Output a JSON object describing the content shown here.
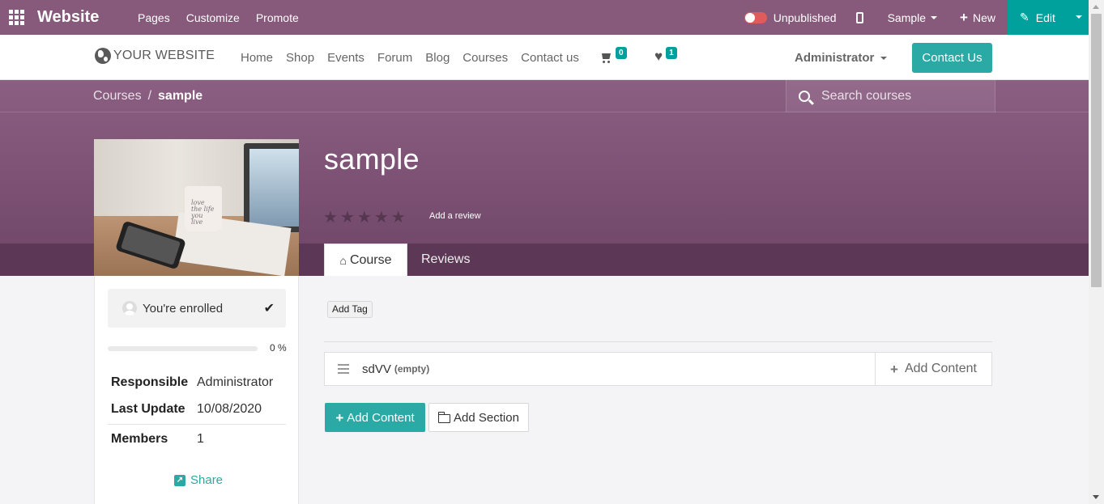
{
  "adminbar": {
    "app_title": "Website",
    "menu": [
      "Pages",
      "Customize",
      "Promote"
    ],
    "publish_status": "Unpublished",
    "sample_label": "Sample",
    "new_label": "New",
    "edit_label": "Edit"
  },
  "sitenav": {
    "logo_text": "YOUR WEBSITE",
    "links": [
      "Home",
      "Shop",
      "Events",
      "Forum",
      "Blog",
      "Courses",
      "Contact us"
    ],
    "cart_count": "0",
    "wishlist_count": "1",
    "user": "Administrator",
    "contact_button": "Contact Us"
  },
  "breadcrumb": {
    "parent": "Courses",
    "separator": "/",
    "current": "sample"
  },
  "search": {
    "placeholder": "Search courses"
  },
  "course": {
    "title": "sample",
    "rating_stars": 0,
    "add_review": "Add a review",
    "tabs": [
      "Course",
      "Reviews"
    ]
  },
  "sidebar": {
    "enrolled_text": "You're enrolled",
    "progress_text": "0 %",
    "progress_value": 0,
    "info": [
      {
        "key": "Responsible",
        "value": "Administrator"
      },
      {
        "key": "Last Update",
        "value": "10/08/2020"
      },
      {
        "key": "Members",
        "value": "1"
      }
    ],
    "share_label": "Share"
  },
  "content": {
    "add_tag": "Add Tag",
    "section_name": "sdVV",
    "section_state": "(empty)",
    "section_add_content": "Add Content",
    "add_content_button": "Add Content",
    "add_section_button": "Add Section"
  },
  "colors": {
    "brand_purple": "#875a7b",
    "accent_teal": "#00a09d",
    "button_teal": "#2ba9a4"
  }
}
